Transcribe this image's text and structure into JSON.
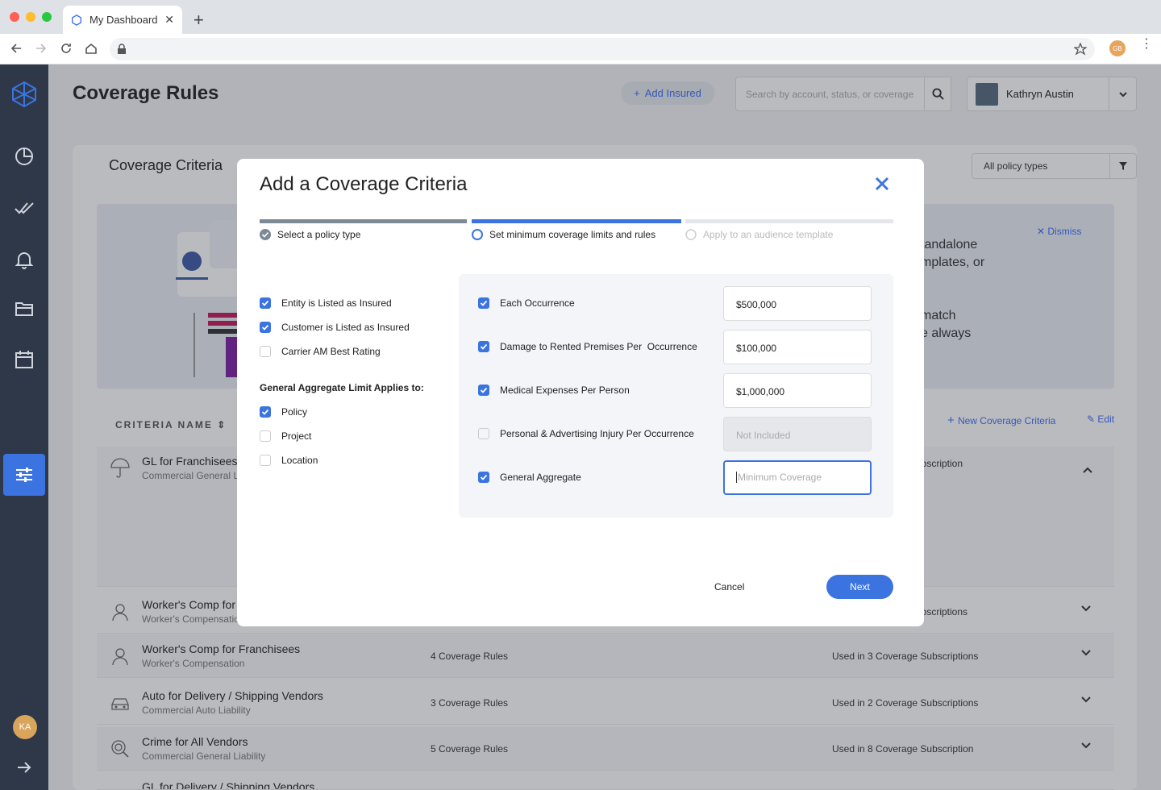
{
  "browser": {
    "tab_title": "My Dashboard",
    "profile_initials": "GB"
  },
  "header": {
    "title": "Coverage Rules",
    "add_insured": "Add Insured",
    "search_placeholder": "Search by account, status, or coverage",
    "user_name": "Kathryn Austin"
  },
  "sidebar": {
    "user_initials": "KA"
  },
  "section": {
    "tab": "Coverage Criteria",
    "policy_filter": "All policy types"
  },
  "banner": {
    "line1": "tandalone",
    "line2": "mplates, or",
    "line3": "match",
    "line4": "e always",
    "dismiss": "Dismiss"
  },
  "list": {
    "column_header": "CRITERIA NAME",
    "new_label": "New Coverage Criteria",
    "edit_label": "Edit",
    "rows": [
      {
        "name": "GL for Franchisees",
        "type": "Commercial General L",
        "rules": "",
        "used": "ubscription"
      },
      {
        "name": "Worker's Comp for",
        "type": "Worker's Compensatio",
        "rules": "",
        "used": "ubscriptions"
      },
      {
        "name": "Worker's Comp for Franchisees",
        "type": "Worker's Compensation",
        "rules": "4 Coverage Rules",
        "used": "Used in 3 Coverage Subscriptions"
      },
      {
        "name": "Auto for Delivery / Shipping Vendors",
        "type": "Commercial Auto Liability",
        "rules": "3 Coverage Rules",
        "used": "Used in 2 Coverage Subscriptions"
      },
      {
        "name": "Crime for All Vendors",
        "type": "Commercial General Liability",
        "rules": "5 Coverage Rules",
        "used": "Used in 8 Coverage Subscription"
      },
      {
        "name": "GL for Delivery / Shipping Vendors",
        "type": "",
        "rules": "",
        "used": ""
      }
    ]
  },
  "modal": {
    "title": "Add a Coverage Criteria",
    "steps": [
      {
        "label": "Select a policy type"
      },
      {
        "label": "Set minimum coverage limits and rules"
      },
      {
        "label": "Apply to an audience template"
      }
    ],
    "options": [
      {
        "label": "Entity is Listed as Insured",
        "checked": true
      },
      {
        "label": "Customer is Listed as Insured",
        "checked": true
      },
      {
        "label": "Carrier AM Best Rating",
        "checked": false
      }
    ],
    "aggregate_heading": "General Aggregate Limit Applies to:",
    "aggregate": [
      {
        "label": "Policy",
        "checked": true
      },
      {
        "label": "Project",
        "checked": false
      },
      {
        "label": "Location",
        "checked": false
      }
    ],
    "limits": [
      {
        "label": "Each Occurrence",
        "checked": true,
        "value": "$500,000"
      },
      {
        "label": "Damage to Rented Premises Per  Occurrence",
        "checked": true,
        "value": "$100,000"
      },
      {
        "label": "Medical Expenses Per Person",
        "checked": true,
        "value": "$1,000,000"
      },
      {
        "label": "Personal & Advertising Injury Per Occurrence",
        "checked": false,
        "value": "Not Included"
      },
      {
        "label": "General Aggregate",
        "checked": true,
        "placeholder": "Minimum Coverage"
      }
    ],
    "cancel": "Cancel",
    "next": "Next"
  }
}
